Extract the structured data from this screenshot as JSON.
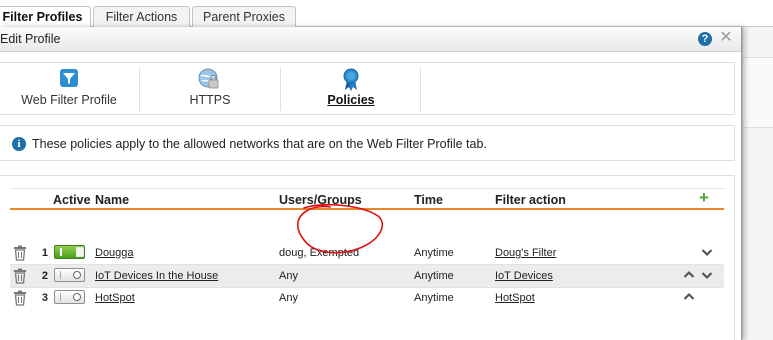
{
  "outer_tabs": [
    {
      "label": "Filter Profiles",
      "active": true
    },
    {
      "label": "Filter Actions",
      "active": false
    },
    {
      "label": "Parent Proxies",
      "active": false
    }
  ],
  "dialog": {
    "title": "Edit Profile",
    "help_icon": "question-circle-icon",
    "close_icon": "close-x-icon"
  },
  "profile_tabs": [
    {
      "label": "Web Filter Profile",
      "icon": "funnel-icon",
      "active": false
    },
    {
      "label": "HTTPS",
      "icon": "globe-lock-icon",
      "active": false
    },
    {
      "label": "Policies",
      "icon": "ribbon-badge-icon",
      "active": true
    }
  ],
  "info": {
    "icon": "info-icon",
    "text": "These policies apply to the allowed networks that are on the Web Filter Profile tab."
  },
  "table": {
    "headers": {
      "active": "Active",
      "name": "Name",
      "users": "Users/Groups",
      "time": "Time",
      "action": "Filter action"
    },
    "add_icon": "plus-icon",
    "rows": [
      {
        "num": "1",
        "active": true,
        "name": "Dougga",
        "users": "doug, Exempted",
        "time": "Anytime",
        "action": "Doug's Filter",
        "up": false,
        "down": true
      },
      {
        "num": "2",
        "active": false,
        "name": "IoT Devices In the House",
        "users": "Any",
        "time": "Anytime",
        "action": "IoT Devices",
        "up": true,
        "down": true
      },
      {
        "num": "3",
        "active": false,
        "name": "HotSpot",
        "users": "Any",
        "time": "Anytime",
        "action": "HotSpot",
        "up": true,
        "down": false
      }
    ]
  },
  "colors": {
    "accent_orange": "#e8862a",
    "toggle_green": "#4b9f1e",
    "info_blue": "#1d6fa5",
    "annotation_red": "#e01010"
  }
}
